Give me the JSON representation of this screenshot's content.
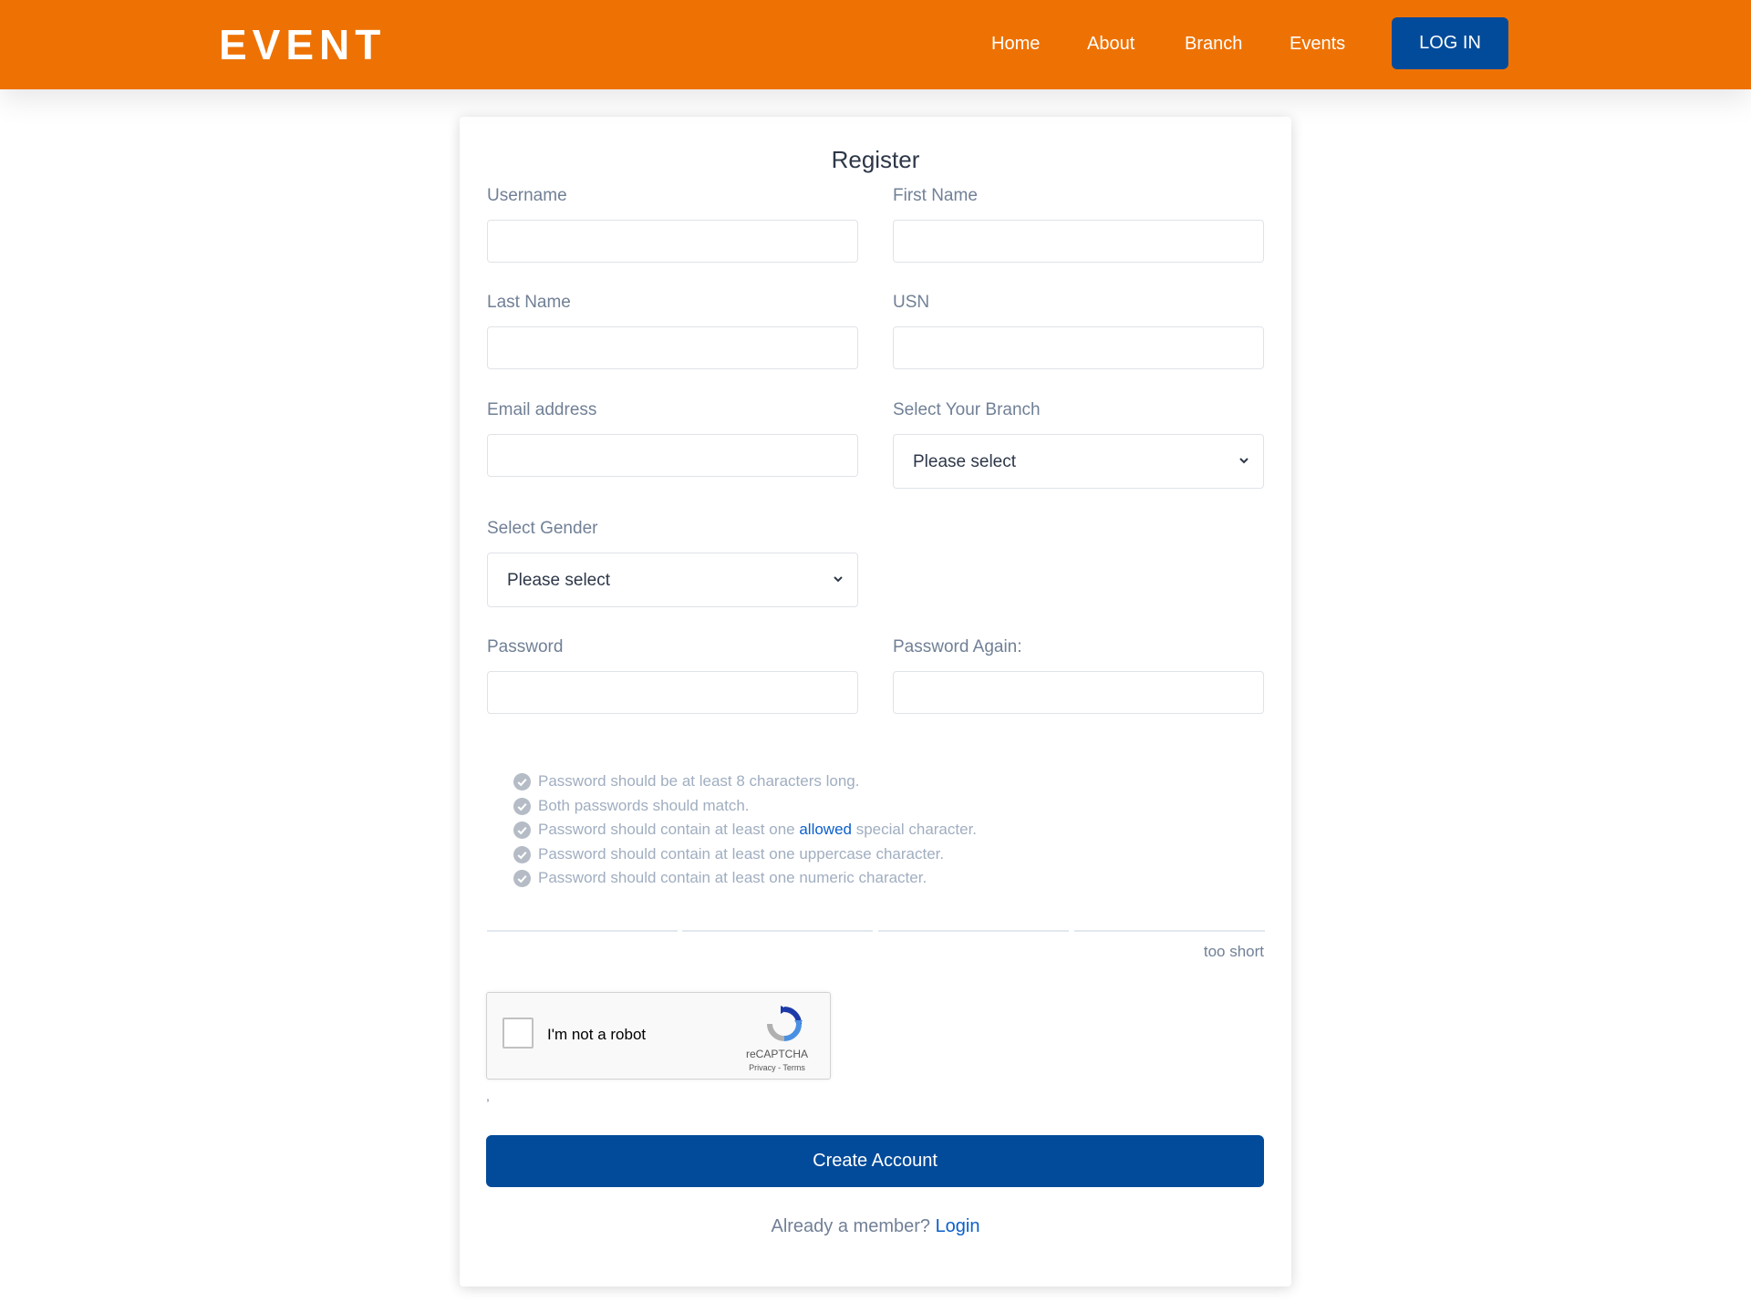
{
  "navbar": {
    "brand": "EVENT",
    "links": [
      "Home",
      "About",
      "Branch",
      "Events"
    ],
    "login_label": "LOG IN"
  },
  "form": {
    "title": "Register",
    "username": {
      "label": "Username",
      "value": ""
    },
    "first_name": {
      "label": "First Name",
      "value": ""
    },
    "last_name": {
      "label": "Last Name",
      "value": ""
    },
    "usn": {
      "label": "USN",
      "value": ""
    },
    "email": {
      "label": "Email address",
      "value": ""
    },
    "branch": {
      "label": "Select Your Branch",
      "selected": "Please select"
    },
    "gender": {
      "label": "Select Gender",
      "selected": "Please select"
    },
    "password": {
      "label": "Password",
      "value": ""
    },
    "password_again": {
      "label": "Password Again:",
      "value": ""
    }
  },
  "password_rules": {
    "rule1": "Password should be at least 8 characters long.",
    "rule2": "Both passwords should match.",
    "rule3_before": "Password should contain at least one ",
    "rule3_link": "allowed",
    "rule3_after": " special character.",
    "rule4": "Password should contain at least one uppercase character.",
    "rule5": "Password should contain at least one numeric character."
  },
  "strength": {
    "text": "too short"
  },
  "captcha": {
    "label": "I'm not a robot",
    "brand": "reCAPTCHA",
    "terms": "Privacy - Terms",
    "stray": ","
  },
  "submit": {
    "label": "Create Account"
  },
  "footer": {
    "prompt": "Already a member? ",
    "link": "Login"
  },
  "colors": {
    "nav_bg": "#ee7203",
    "primary": "#024b9a",
    "link": "#0b5fcc"
  },
  "icons": {
    "rule_check": "check-circle-icon",
    "select_chevron": "chevron-down-icon",
    "captcha_logo": "recaptcha-logo-icon"
  }
}
